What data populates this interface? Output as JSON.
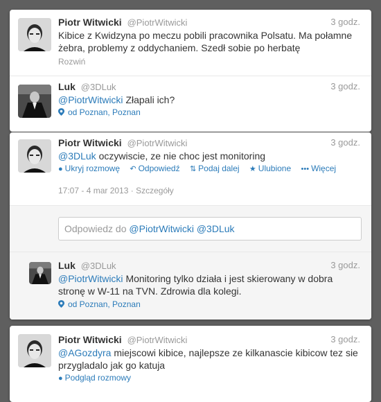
{
  "tweets": [
    {
      "name": "Piotr Witwicki",
      "handle": "@PiotrWitwicki",
      "time": "3 godz.",
      "text": "Kibice z Kwidzyna po meczu pobili pracownika Polsatu. Ma połamne żebra, problemy z oddychaniem. Szedł sobie po herbatę",
      "expand": "Rozwiń"
    },
    {
      "name": "Luk",
      "handle": "@3DLuk",
      "time": "3 godz.",
      "mention": "@PiotrWitwicki",
      "text": "Złapali ich?",
      "location": "od Poznan, Poznan"
    },
    {
      "name": "Piotr Witwicki",
      "handle": "@PiotrWitwicki",
      "time": "3 godz.",
      "mention": "@3DLuk",
      "text": "oczywiscie, ze nie choc jest monitoring",
      "actions": {
        "hide": "Ukryj rozmowę",
        "reply": "Odpowiedź",
        "retweet": "Podaj dalej",
        "favorite": "Ulubione",
        "more": "Więcej"
      },
      "timestamp": "17:07 - 4 mar 2013",
      "details": "Szczegóły"
    },
    {
      "name": "Luk",
      "handle": "@3DLuk",
      "time": "3 godz.",
      "mention": "@PiotrWitwicki",
      "text": "Monitoring tylko działa i jest skierowany w dobra stronę w W-11 na TVN. Zdrowia dla kolegi.",
      "location": "od Poznan, Poznan"
    },
    {
      "name": "Piotr Witwicki",
      "handle": "@PiotrWitwicki",
      "time": "3 godz.",
      "mention": "@AGozdyra",
      "text": "miejscowi kibice, najlepsze ze kilkanascie kibicow tez sie przygladalo jak go katuja",
      "view_conversation": "Podgląd rozmowy"
    }
  ],
  "reply_box": {
    "prefix": "Odpowiedz do",
    "mention1": "@PiotrWitwicki",
    "mention2": "@3DLuk"
  },
  "colors": {
    "link": "#2b7bb9",
    "muted": "#999999",
    "background": "#5f5f5f"
  }
}
